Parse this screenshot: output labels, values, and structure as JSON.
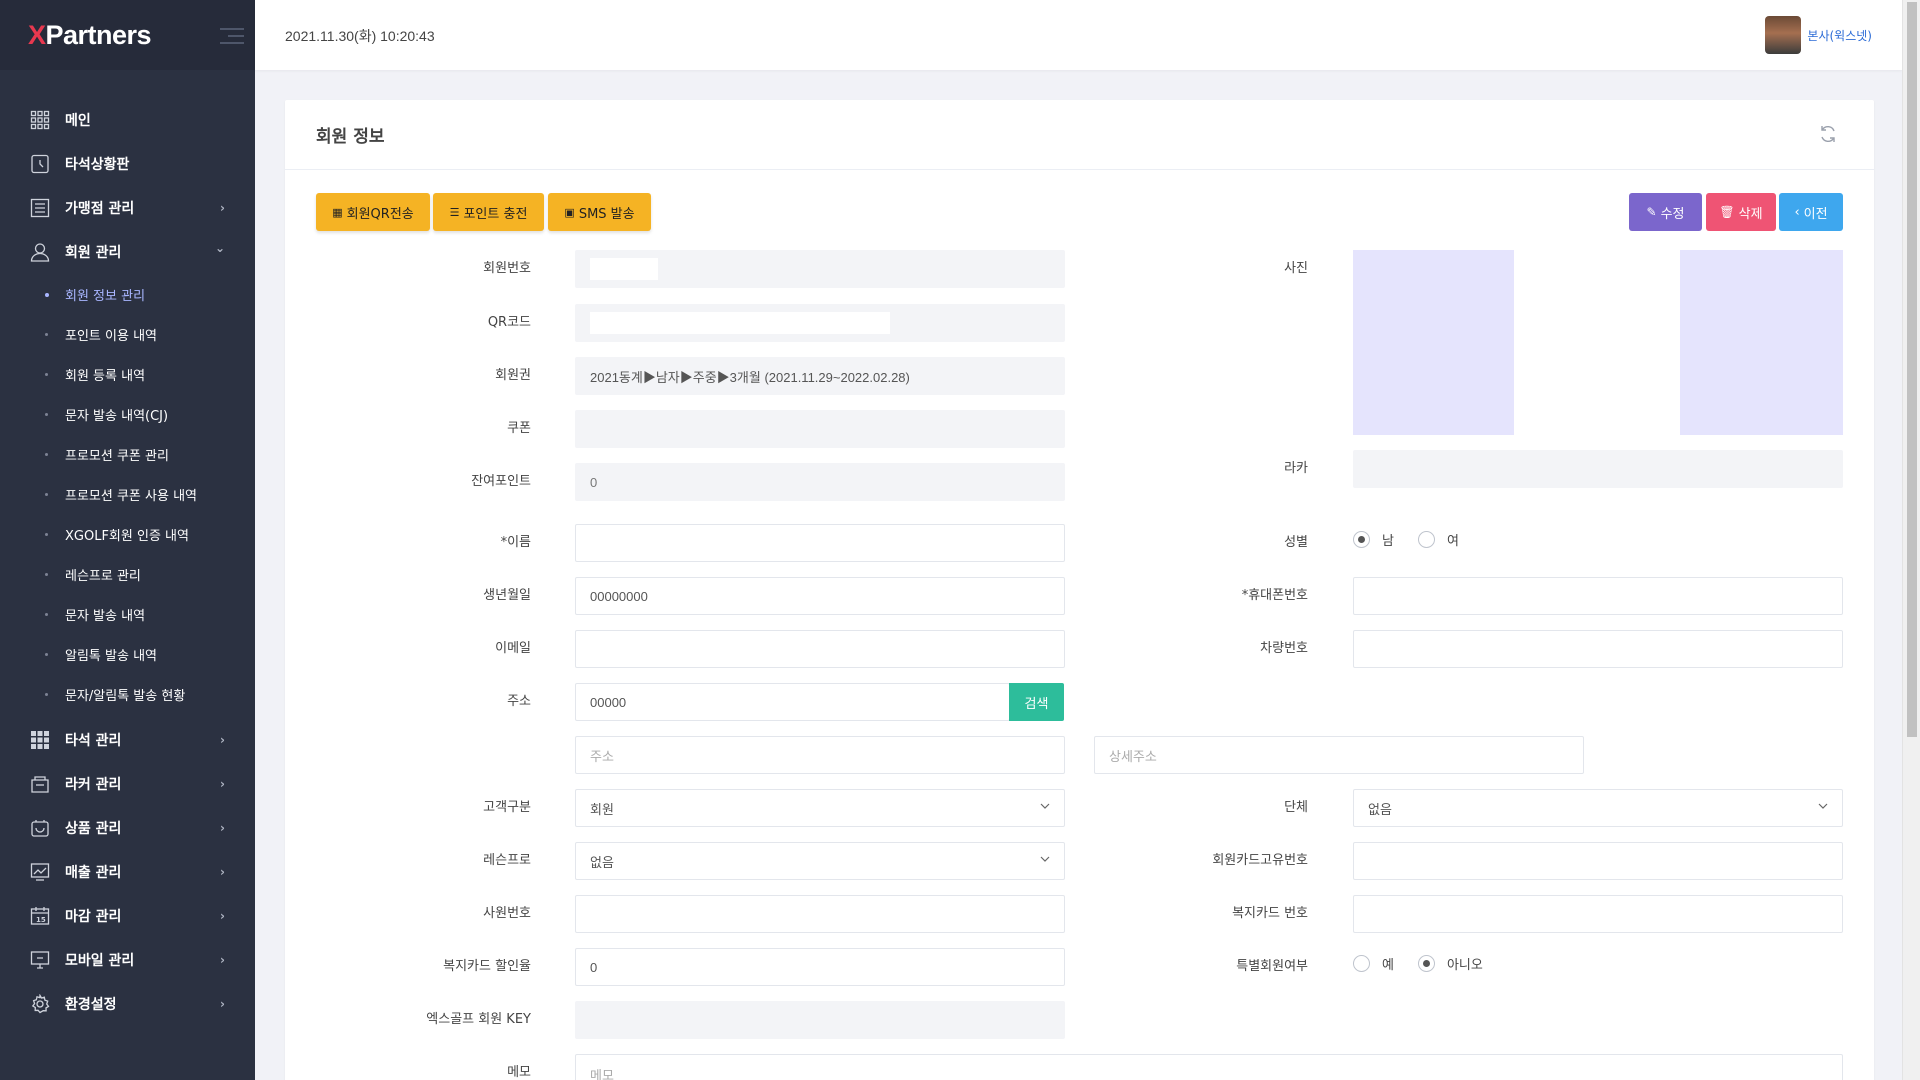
{
  "app": {
    "logo_x": "X",
    "logo_rest": "Partners"
  },
  "header": {
    "datetime": "2021.11.30(화) 10:20:43",
    "user_name": "본사(윅스넷)"
  },
  "sidebar": {
    "items": [
      {
        "label": "메인",
        "icon": "grid-icon",
        "has_children": false
      },
      {
        "label": "타석상황판",
        "icon": "clock-icon",
        "has_children": false
      },
      {
        "label": "가맹점 관리",
        "icon": "list-icon",
        "has_children": true
      },
      {
        "label": "회원 관리",
        "icon": "user-icon",
        "has_children": true,
        "expanded": true
      }
    ],
    "submenu": [
      {
        "label": "회원 정보 관리",
        "active": true
      },
      {
        "label": "포인트 이용 내역"
      },
      {
        "label": "회원 등록 내역"
      },
      {
        "label": "문자 발송 내역(CJ)"
      },
      {
        "label": "프로모션 쿠폰 관리"
      },
      {
        "label": "프로모션 쿠폰 사용 내역"
      },
      {
        "label": "XGOLF회원 인증 내역"
      },
      {
        "label": "레슨프로 관리"
      },
      {
        "label": "문자 발송 내역"
      },
      {
        "label": "알림톡 발송 내역"
      },
      {
        "label": "문자/알림톡 발송 현황"
      }
    ],
    "items_after": [
      {
        "label": "타석 관리",
        "icon": "apps-icon"
      },
      {
        "label": "라커 관리",
        "icon": "locker-icon"
      },
      {
        "label": "상품 관리",
        "icon": "box-icon"
      },
      {
        "label": "매출 관리",
        "icon": "chart-icon"
      },
      {
        "label": "마감 관리",
        "icon": "calendar-icon"
      },
      {
        "label": "모바일 관리",
        "icon": "monitor-icon"
      },
      {
        "label": "환경설정",
        "icon": "gear-icon"
      }
    ],
    "chevron_right": "›",
    "chevron_down": "⌄"
  },
  "card": {
    "title": "회원 정보",
    "buttons": {
      "qr": "회원QR전송",
      "point": "포인트 충전",
      "sms": "SMS 발송",
      "edit": "수정",
      "delete": "삭제",
      "back": "이전"
    }
  },
  "form": {
    "member_no": {
      "label": "회원번호",
      "value": ""
    },
    "qr_code": {
      "label": "QR코드",
      "value": ""
    },
    "membership": {
      "label": "회원권",
      "value": "2021동계▶남자▶주중▶3개월 (2021.11.29~2022.02.28)"
    },
    "coupon": {
      "label": "쿠폰",
      "value": ""
    },
    "points": {
      "label": "잔여포인트",
      "value": "0"
    },
    "name": {
      "label": "*이름",
      "value": ""
    },
    "birth": {
      "label": "생년월일",
      "value": "00000000"
    },
    "email": {
      "label": "이메일",
      "value": ""
    },
    "address": {
      "label": "주소",
      "zip": "00000",
      "search": "검색",
      "addr_placeholder": "주소",
      "detail_placeholder": "상세주소"
    },
    "customer_type": {
      "label": "고객구분",
      "value": "회원"
    },
    "lesson_pro": {
      "label": "레슨프로",
      "value": "없음"
    },
    "employee_no": {
      "label": "사원번호",
      "value": ""
    },
    "welfare_discount": {
      "label": "복지카드 할인율",
      "value": "0"
    },
    "xgolf_key": {
      "label": "엑스골프 회원 KEY",
      "value": ""
    },
    "memo": {
      "label": "메모",
      "placeholder": "메모"
    },
    "photo": {
      "label": "사진"
    },
    "locker": {
      "label": "라카",
      "value": ""
    },
    "gender": {
      "label": "성별",
      "options": [
        "남",
        "여"
      ],
      "selected": "남"
    },
    "phone": {
      "label": "*휴대폰번호",
      "value": ""
    },
    "car_no": {
      "label": "차량번호",
      "value": ""
    },
    "group": {
      "label": "단체",
      "value": "없음"
    },
    "card_uid": {
      "label": "회원카드고유번호",
      "value": ""
    },
    "welfare_card": {
      "label": "복지카드 번호",
      "value": ""
    },
    "special_member": {
      "label": "특별회원여부",
      "options": [
        "예",
        "아니오"
      ],
      "selected": "아니오"
    }
  }
}
